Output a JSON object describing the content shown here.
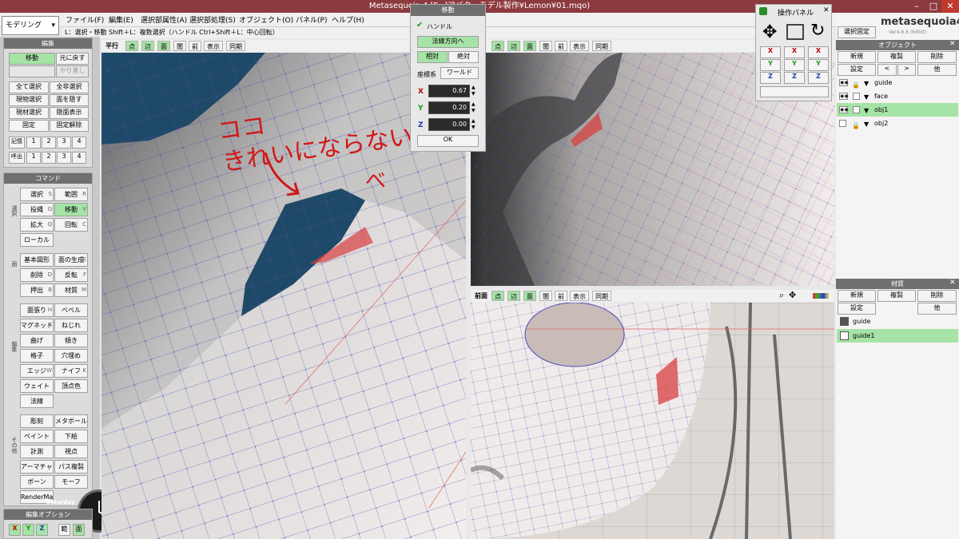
{
  "window": {
    "title": "Metasequoia 4 [F...]アバターモデル製作¥Lemon¥01.mqo)",
    "title_hidden_prefix": "[F",
    "close": "✕"
  },
  "mode": {
    "label": "モデリング"
  },
  "menu": [
    "ファイル(F)",
    "編集(E)",
    "選択部属性(A)",
    "選択部処理(S)",
    "オブジェクト(O)",
    "パネル(P)",
    "ヘルプ(H)"
  ],
  "hint": "L：選択・移動  Shift＋L：複数選択（ハンドル  Ctrl+Shift＋L：中心回転）",
  "edit_panel": {
    "title": "編集",
    "move": "移動",
    "undo": "元に戻す",
    "redo": "やり直し",
    "select_all": "全て選択",
    "deselect_all": "全非選択",
    "cur_select": "現物選択",
    "hide_face": "面を隠す",
    "cur_select2": "現材選択",
    "show_hidden": "隠面表示",
    "fix": "固定",
    "unfix": "固定解除",
    "memory_label": "記憶",
    "recall_label": "呼出",
    "slots": [
      "1",
      "2",
      "3",
      "4"
    ]
  },
  "command_panel": {
    "title": "コマンド",
    "groups": {
      "select": "選択",
      "face": "面",
      "edit": "編集",
      "misc": "その他"
    },
    "buttons": [
      {
        "label": "選択",
        "key": "S"
      },
      {
        "label": "範囲",
        "key": "R"
      },
      {
        "label": "投縄",
        "key": "G"
      },
      {
        "label": "移動",
        "key": "V"
      },
      {
        "label": "拡大",
        "key": "Q"
      },
      {
        "label": "回転",
        "key": "C"
      },
      {
        "label": "ローカル",
        "key": ""
      },
      {
        "label": "基本図形",
        "key": ""
      },
      {
        "label": "面の生成",
        "key": "E"
      },
      {
        "label": "削除",
        "key": "D"
      },
      {
        "label": "反転",
        "key": "F"
      },
      {
        "label": "押出",
        "key": "B"
      },
      {
        "label": "材質",
        "key": "M"
      },
      {
        "label": "面張り",
        "key": "H"
      },
      {
        "label": "ベベル",
        "key": ""
      },
      {
        "label": "マグネット",
        "key": "T"
      },
      {
        "label": "ねじれ",
        "key": ""
      },
      {
        "label": "曲げ",
        "key": ""
      },
      {
        "label": "傾き",
        "key": ""
      },
      {
        "label": "格子",
        "key": ""
      },
      {
        "label": "穴埋め",
        "key": ""
      },
      {
        "label": "エッジ",
        "key": "W"
      },
      {
        "label": "ナイフ",
        "key": "K"
      },
      {
        "label": "ウェイト",
        "key": ""
      },
      {
        "label": "頂点色",
        "key": ""
      },
      {
        "label": "法線",
        "key": ""
      },
      {
        "label": "彫刻",
        "key": ""
      },
      {
        "label": "メタボール",
        "key": ""
      },
      {
        "label": "ペイント",
        "key": ""
      },
      {
        "label": "下絵",
        "key": ""
      },
      {
        "label": "計測",
        "key": ""
      },
      {
        "label": "視点",
        "key": ""
      },
      {
        "label": "アーマチャー",
        "key": ""
      },
      {
        "label": "パス複製",
        "key": ""
      },
      {
        "label": "ボーン",
        "key": ""
      },
      {
        "label": "モーフ",
        "key": ""
      },
      {
        "label": "RenderMan",
        "key": ""
      }
    ]
  },
  "clock": {
    "day": "Saturday"
  },
  "edit_option": {
    "title": "編集オプション",
    "x": "X",
    "y": "Y",
    "z": "Z",
    "range": "範",
    "face": "面"
  },
  "viewport_main": {
    "toolbar": [
      "平行",
      "点",
      "辺",
      "面",
      "闇",
      "前",
      "表示",
      "同期"
    ]
  },
  "viewport_tr": {
    "toolbar": [
      "点",
      "辺",
      "面",
      "闇",
      "前",
      "表示",
      "同期"
    ]
  },
  "viewport_br": {
    "label": "前面",
    "toolbar": [
      "点",
      "辺",
      "面",
      "闇",
      "前",
      "表示",
      "同期"
    ]
  },
  "annotation": {
    "line1": "ココ",
    "line2": "きれいにならない",
    "line3": "べ"
  },
  "move_dialog": {
    "title": "移動",
    "handle": "ハンドル",
    "normal_dir": "法線方向へ",
    "relative": "相対",
    "absolute": "絶対",
    "coord_label": "座標系",
    "coord_value": "ワールド",
    "x_label": "X",
    "y_label": "Y",
    "z_label": "Z",
    "x": "0.67",
    "y": "0.20",
    "z": "0.00",
    "ok": "OK"
  },
  "op_panel": {
    "title": "操作パネル",
    "axes": [
      "X",
      "X",
      "X",
      "Y",
      "Y",
      "Y",
      "Z",
      "Z",
      "Z"
    ]
  },
  "brand": {
    "logo": "metasequoia4",
    "version": "Ver4.6.6 (64bit)",
    "selfix": "選択固定"
  },
  "object_panel": {
    "title": "オブジェクト",
    "new": "新規",
    "dup": "複製",
    "del": "削除",
    "settings": "設定",
    "prev": "<",
    "next": ">",
    "other": "他",
    "items": [
      {
        "name": "guide",
        "visible": true,
        "locked": true,
        "selected": false
      },
      {
        "name": "face",
        "visible": true,
        "locked": false,
        "selected": false
      },
      {
        "name": "obj1",
        "visible": true,
        "locked": false,
        "selected": true
      },
      {
        "name": "obj2",
        "visible": false,
        "locked": true,
        "selected": false
      }
    ]
  },
  "material_panel": {
    "title": "材質",
    "new": "新規",
    "dup": "複製",
    "del": "削除",
    "settings": "設定",
    "other": "他",
    "items": [
      {
        "name": "guide",
        "swatch": "#555555",
        "selected": false
      },
      {
        "name": "guide1",
        "swatch": "#ffffff",
        "selected": true
      }
    ]
  },
  "colors": {
    "title_bar": "#8d3a3f",
    "accent_green": "#a6e3a6",
    "viewport_bg": "#1f4a67",
    "annotation": "#d01818"
  }
}
